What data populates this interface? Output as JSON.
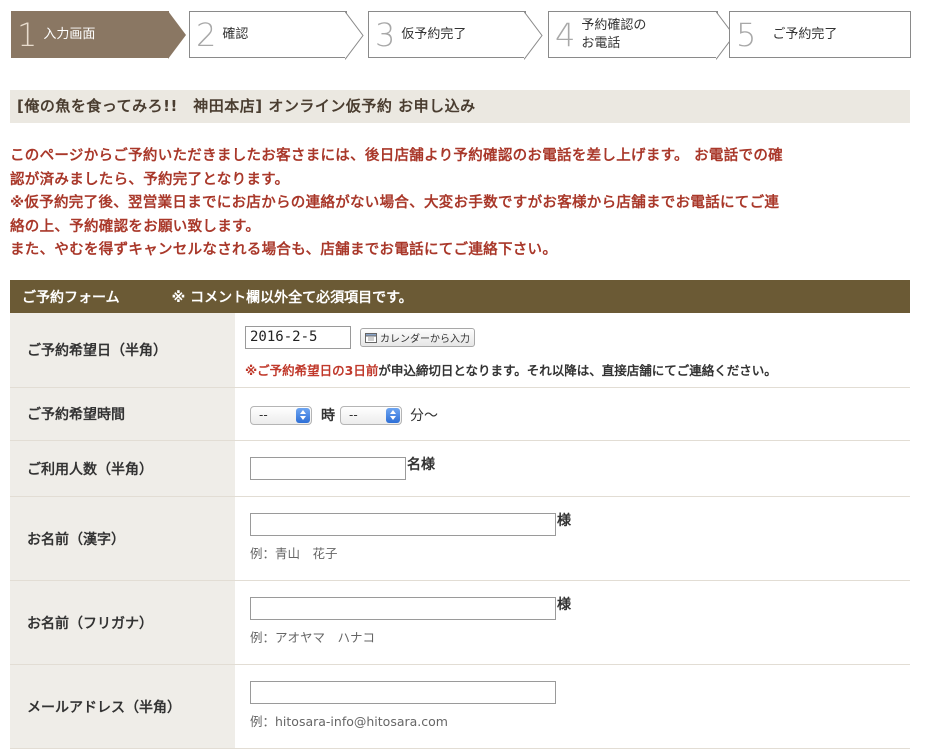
{
  "steps": [
    {
      "num": "1",
      "label": "入力画面",
      "active": true
    },
    {
      "num": "2",
      "label": "確認"
    },
    {
      "num": "3",
      "label": "仮予約完了"
    },
    {
      "num": "4",
      "label_line1": "予約確認の",
      "label_line2": "お電話"
    },
    {
      "num": "5",
      "label": "ご予約完了"
    }
  ],
  "page_title": "[俺の魚を食ってみろ!!　神田本店] オンライン仮予約 お申し込み",
  "notice": {
    "line1": "このページからご予約いただきましたお客さまには、後日店舗より予約確認のお電話を差し上げます。 お電話での確",
    "line2": "認が済みましたら、予約完了となります。",
    "line3": "※仮予約完了後、翌営業日までにお店からの連絡がない場合、大変お手数ですがお客様から店舗までお電話にてご連",
    "line4": "絡の上、予約確認をお願い致します。",
    "line5": "また、やむを得ずキャンセルなされる場合も、店舗までお電話にてご連絡下さい。"
  },
  "form": {
    "header_title": "ご予約フォーム",
    "header_note": "※ コメント欄以外全て必須項目です。",
    "date": {
      "label": "ご予約希望日（半角）",
      "value": "2016-2-5",
      "calendar_button": "カレンダーから入力",
      "deadline_red": "※ご予約希望日の3日前",
      "deadline_rest": "が申込締切日となります。それ以降は、直接店舗にてご連絡ください。"
    },
    "time": {
      "label": "ご予約希望時間",
      "hour_value": "--",
      "hour_suffix": "時",
      "minute_value": "--",
      "minute_suffix": "分〜"
    },
    "people": {
      "label": "ご利用人数（半角）",
      "value": "",
      "suffix": "名様"
    },
    "name_kanji": {
      "label": "お名前（漢字）",
      "value": "",
      "suffix": "様",
      "example": "例：青山　花子"
    },
    "name_kana": {
      "label": "お名前（フリガナ）",
      "value": "",
      "suffix": "様",
      "example": "例：アオヤマ　ハナコ"
    },
    "email": {
      "label": "メールアドレス（半角）",
      "value": "",
      "example": "例：hitosara-info@hitosara.com"
    }
  },
  "colors": {
    "step_active": "#8a7763",
    "heading_bg": "#ebe8e1",
    "notice_text": "#a9382a",
    "form_header_bg": "#6b5a35",
    "label_cell_bg": "#efede8"
  }
}
